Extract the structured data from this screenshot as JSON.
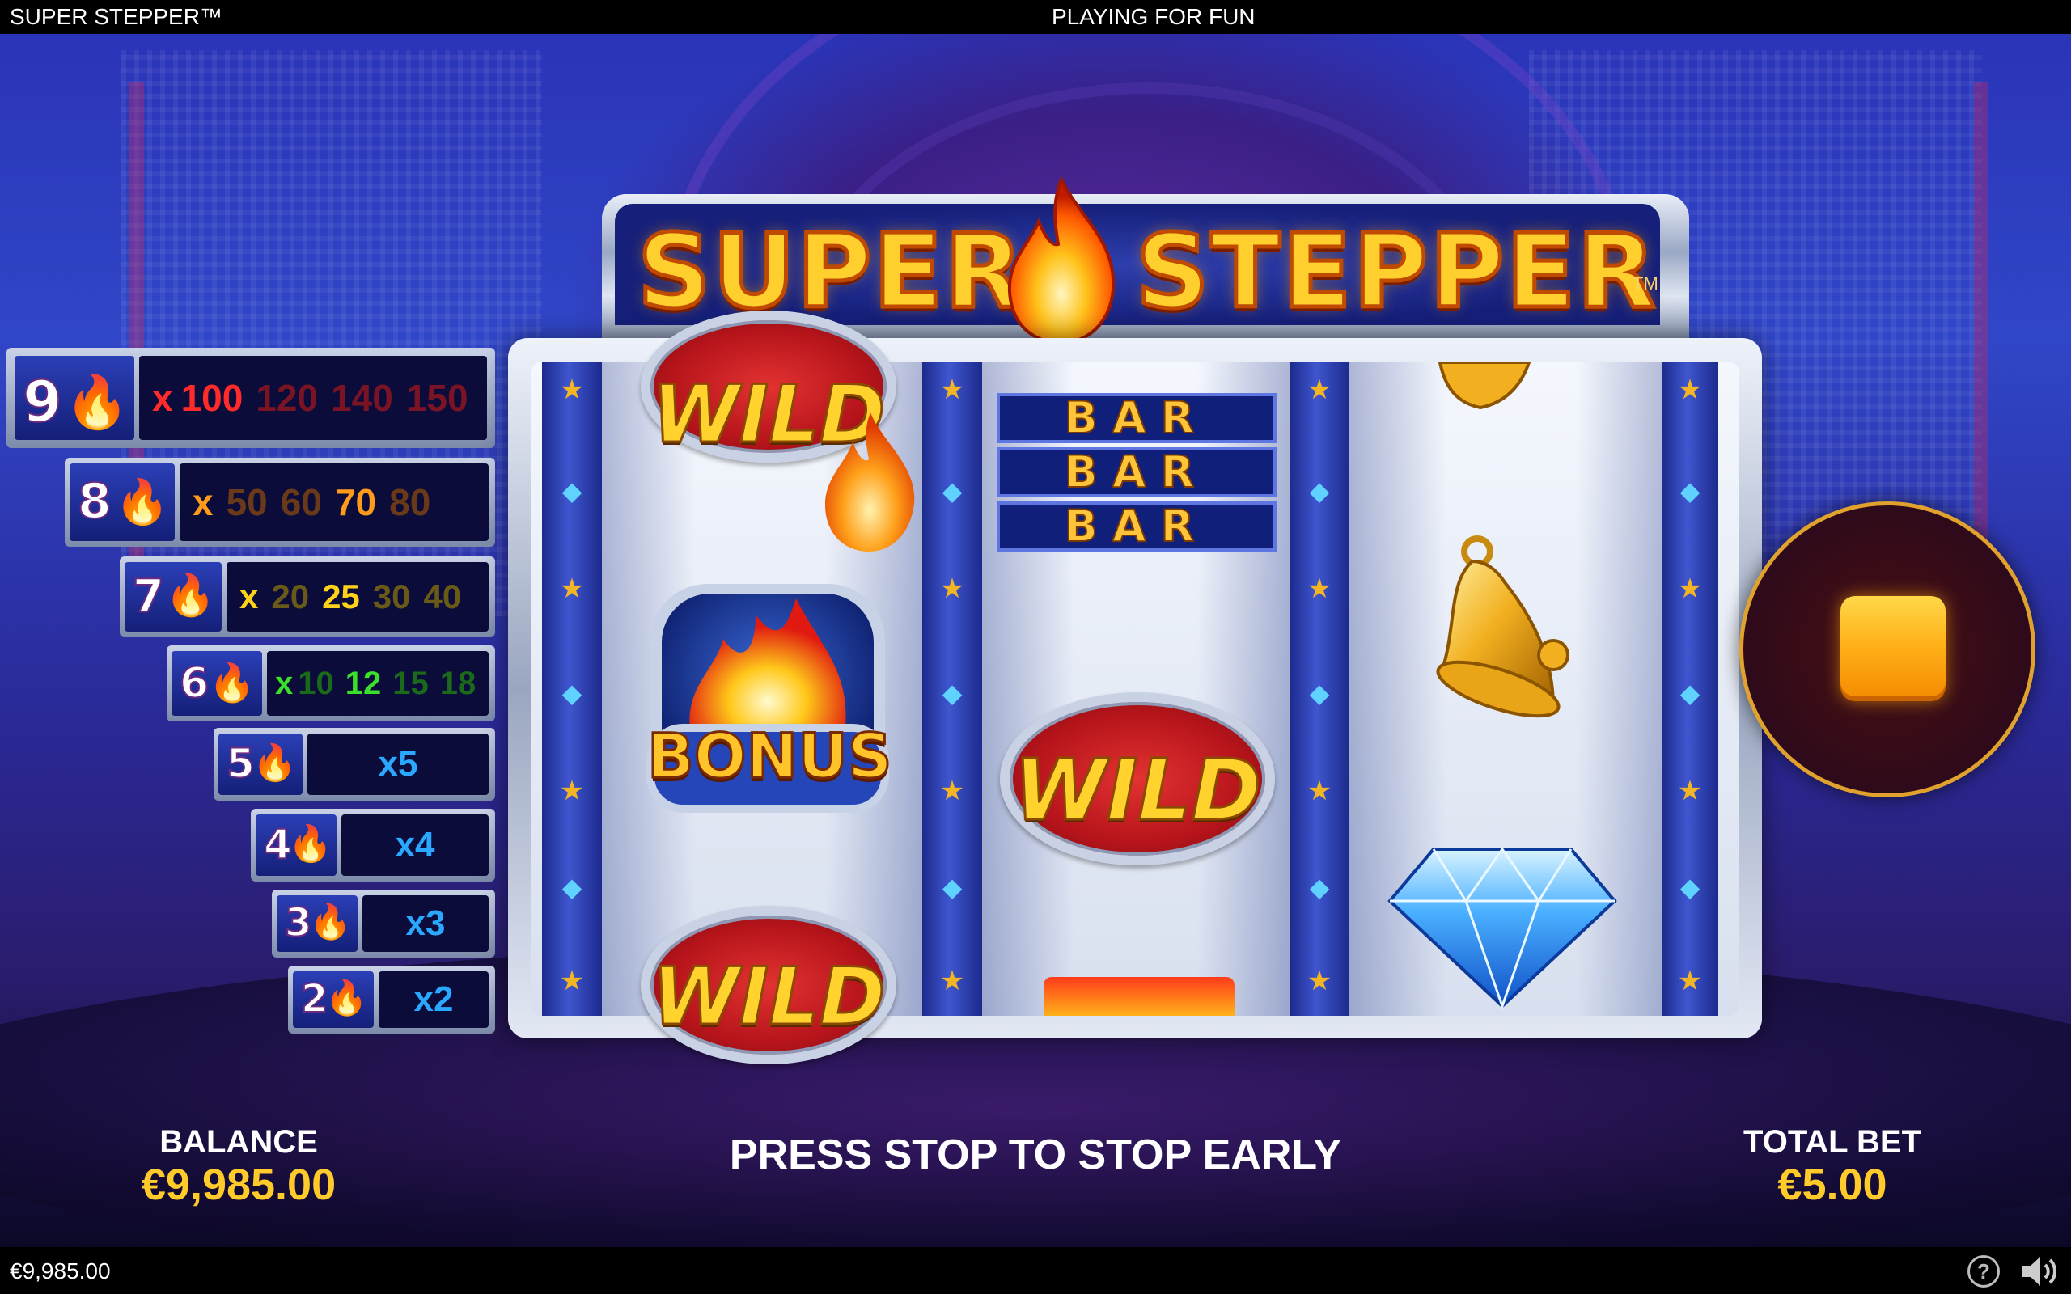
{
  "topbar": {
    "game_name": "SUPER STEPPER™",
    "mode": "PLAYING FOR FUN"
  },
  "logo": {
    "word_left": "SUPER",
    "word_right": "STEPPER",
    "tm": "TM"
  },
  "paytable": [
    {
      "count": "9",
      "prefix": "x",
      "values": [
        "100",
        "120",
        "140",
        "150"
      ],
      "colors": [
        "#ff2a2a",
        "#7a1424",
        "#7a1424",
        "#7a1424"
      ],
      "prefix_color": "#ff2a2a"
    },
    {
      "count": "8",
      "prefix": "x",
      "values": [
        "50",
        "60",
        "70",
        "80"
      ],
      "colors": [
        "#6a3a18",
        "#6a3a18",
        "#ff9a1a",
        "#6a3a18"
      ],
      "prefix_color": "#ff9a1a"
    },
    {
      "count": "7",
      "prefix": "x",
      "values": [
        "20",
        "25",
        "30",
        "40"
      ],
      "colors": [
        "#6a5a18",
        "#ffd21a",
        "#6a5a18",
        "#6a5a18"
      ],
      "prefix_color": "#ffd21a"
    },
    {
      "count": "6",
      "prefix": "x",
      "values": [
        "10",
        "12",
        "15",
        "18"
      ],
      "colors": [
        "#1a6a1a",
        "#3ae02a",
        "#1a6a1a",
        "#1a6a1a"
      ],
      "prefix_color": "#3ae02a"
    },
    {
      "count": "5",
      "single": "x5"
    },
    {
      "count": "4",
      "single": "x4"
    },
    {
      "count": "3",
      "single": "x3"
    },
    {
      "count": "2",
      "single": "x2"
    }
  ],
  "reels": {
    "reel1": [
      "WILD",
      "BONUS",
      "WILD"
    ],
    "reel2": [
      "BAR",
      "BAR",
      "BAR",
      "WILD"
    ],
    "reel3": [
      "bell-symbol",
      "bell-symbol",
      "diamond-symbol"
    ]
  },
  "bonus_label": "BONUS",
  "wild_label": "WILD",
  "bar_label": "BAR",
  "balance": {
    "label": "BALANCE",
    "value": "€9,985.00"
  },
  "message": "PRESS STOP TO STOP EARLY",
  "total_bet": {
    "label": "TOTAL BET",
    "value": "€5.00"
  },
  "bottombar": {
    "balance_small": "€9,985.00"
  },
  "icons": {
    "help": "?",
    "sound": "speaker-icon",
    "stop": "stop-icon"
  },
  "colors": {
    "accent": "#ffcb2a",
    "stop_ring": "#e0a22c"
  }
}
